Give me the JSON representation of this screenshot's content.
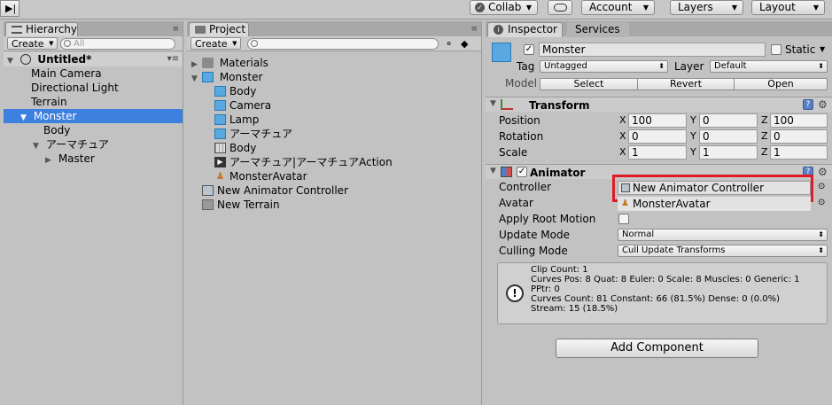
{
  "toolbar": {
    "collab_label": "Collab",
    "account_label": "Account",
    "layers_label": "Layers",
    "layout_label": "Layout"
  },
  "hierarchy": {
    "tab_label": "Hierarchy",
    "create_label": "Create",
    "search_placeholder": "All",
    "scene_name": "Untitled*",
    "items": [
      {
        "label": "Main Camera"
      },
      {
        "label": "Directional Light"
      },
      {
        "label": "Terrain"
      },
      {
        "label": "Monster"
      },
      {
        "label": "Body"
      },
      {
        "label": "アーマチュア"
      },
      {
        "label": "Master"
      }
    ]
  },
  "project": {
    "tab_label": "Project",
    "create_label": "Create",
    "items": [
      {
        "label": "Materials"
      },
      {
        "label": "Monster"
      },
      {
        "label": "Body"
      },
      {
        "label": "Camera"
      },
      {
        "label": "Lamp"
      },
      {
        "label": "アーマチュア"
      },
      {
        "label": "Body"
      },
      {
        "label": "アーマチュア|アーマチュアAction"
      },
      {
        "label": "MonsterAvatar"
      },
      {
        "label": "New Animator Controller"
      },
      {
        "label": "New Terrain"
      }
    ]
  },
  "inspector": {
    "tab_label": "Inspector",
    "services_tab_label": "Services",
    "object_name": "Monster",
    "static_label": "Static",
    "tag_label": "Tag",
    "tag_value": "Untagged",
    "layer_label": "Layer",
    "layer_value": "Default",
    "model_label": "Model",
    "select_label": "Select",
    "revert_label": "Revert",
    "open_label": "Open",
    "transform": {
      "title": "Transform",
      "position_label": "Position",
      "rotation_label": "Rotation",
      "scale_label": "Scale",
      "axis_x": "X",
      "axis_y": "Y",
      "axis_z": "Z",
      "position": {
        "x": "100",
        "y": "0",
        "z": "100"
      },
      "rotation": {
        "x": "0",
        "y": "0",
        "z": "0"
      },
      "scale": {
        "x": "1",
        "y": "1",
        "z": "1"
      }
    },
    "animator": {
      "title": "Animator",
      "controller_label": "Controller",
      "controller_value": "New Animator Controller",
      "avatar_label": "Avatar",
      "avatar_value": "MonsterAvatar",
      "apply_root_motion_label": "Apply Root Motion",
      "update_mode_label": "Update Mode",
      "update_mode_value": "Normal",
      "culling_mode_label": "Culling Mode",
      "culling_mode_value": "Cull Update Transforms",
      "info_lines": [
        "Clip Count: 1",
        "Curves Pos: 8 Quat: 8 Euler: 0 Scale: 8 Muscles: 0 Generic: 1",
        "PPtr: 0",
        "Curves Count: 81 Constant: 66 (81.5%) Dense: 0 (0.0%)",
        "Stream: 15 (18.5%)"
      ]
    },
    "add_component_label": "Add Component"
  },
  "colors": {
    "selection": "#3d80df",
    "highlight": "#e01b24",
    "panel_bg": "#c2c2c2"
  }
}
